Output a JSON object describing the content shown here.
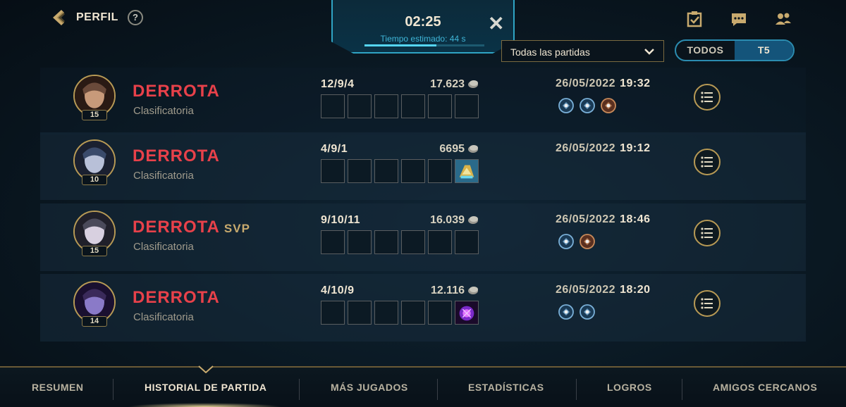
{
  "header": {
    "title": "PERFIL",
    "help": "?"
  },
  "queue": {
    "time": "02:25",
    "estimate": "Tiempo estimado: 44 s",
    "progress": 0.6
  },
  "filter": {
    "selected": "Todas las partidas"
  },
  "toggle": {
    "options": [
      "TODOS",
      "T5"
    ],
    "active": "T5"
  },
  "matches": [
    {
      "result": "DERROTA",
      "svp": "",
      "mode": "Clasificatoria",
      "level": "15",
      "kda": "12/9/4",
      "gold": "17.623",
      "date": "26/05/2022",
      "time": "19:32",
      "items": [
        "",
        "",
        "",
        "",
        "",
        ""
      ],
      "badges": [
        "spell-badge",
        "spell-badge",
        "spell-badge-bronze"
      ]
    },
    {
      "result": "DERROTA",
      "svp": "",
      "mode": "Clasificatoria",
      "level": "10",
      "kda": "4/9/1",
      "gold": "6695",
      "date": "26/05/2022",
      "time": "19:12",
      "items": [
        "",
        "",
        "",
        "",
        "",
        "gold-item"
      ],
      "badges": []
    },
    {
      "result": "DERROTA",
      "svp": "SVP",
      "mode": "Clasificatoria",
      "level": "15",
      "kda": "9/10/11",
      "gold": "16.039",
      "date": "26/05/2022",
      "time": "18:46",
      "items": [
        "",
        "",
        "",
        "",
        "",
        ""
      ],
      "badges": [
        "spell-badge",
        "spell-badge-bronze"
      ]
    },
    {
      "result": "DERROTA",
      "svp": "",
      "mode": "Clasificatoria",
      "level": "14",
      "kda": "4/10/9",
      "gold": "12.116",
      "date": "26/05/2022",
      "time": "18:20",
      "items": [
        "",
        "",
        "",
        "",
        "",
        "purple-item"
      ],
      "badges": [
        "spell-badge",
        "spell-badge"
      ]
    }
  ],
  "nav": {
    "items": [
      "RESUMEN",
      "HISTORIAL DE PARTIDA",
      "MÁS JUGADOS",
      "ESTADÍSTICAS",
      "LOGROS",
      "AMIGOS CERCANOS"
    ],
    "active": "HISTORIAL DE PARTIDA"
  },
  "colors": {
    "defeat": "#e8414a",
    "gold_border": "#b89a55",
    "accent_blue": "#2fa4c4"
  }
}
